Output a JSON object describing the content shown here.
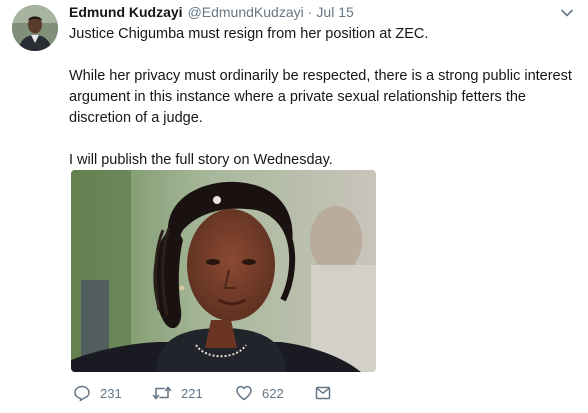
{
  "tweet": {
    "author_name": "Edmund Kudzayi",
    "author_handle": "@EdmundKudzayi",
    "separator": "·",
    "timestamp": "Jul 15",
    "paragraphs": [
      "Justice Chigumba must resign from her position at ZEC.",
      "While her privacy must ordinarily be respected, there is a strong public interest argument in this instance where a private sexual relationship fetters the discretion of a judge.",
      "I will publish the full story on Wednesday."
    ]
  },
  "actions": {
    "replies": "231",
    "retweets": "221",
    "likes": "622"
  },
  "icons": {
    "reply": "reply-icon",
    "retweet": "retweet-icon",
    "like": "heart-icon",
    "dm": "envelope-icon",
    "more": "chevron-down-icon"
  },
  "colors": {
    "text_primary": "#14171a",
    "text_secondary": "#657786"
  }
}
